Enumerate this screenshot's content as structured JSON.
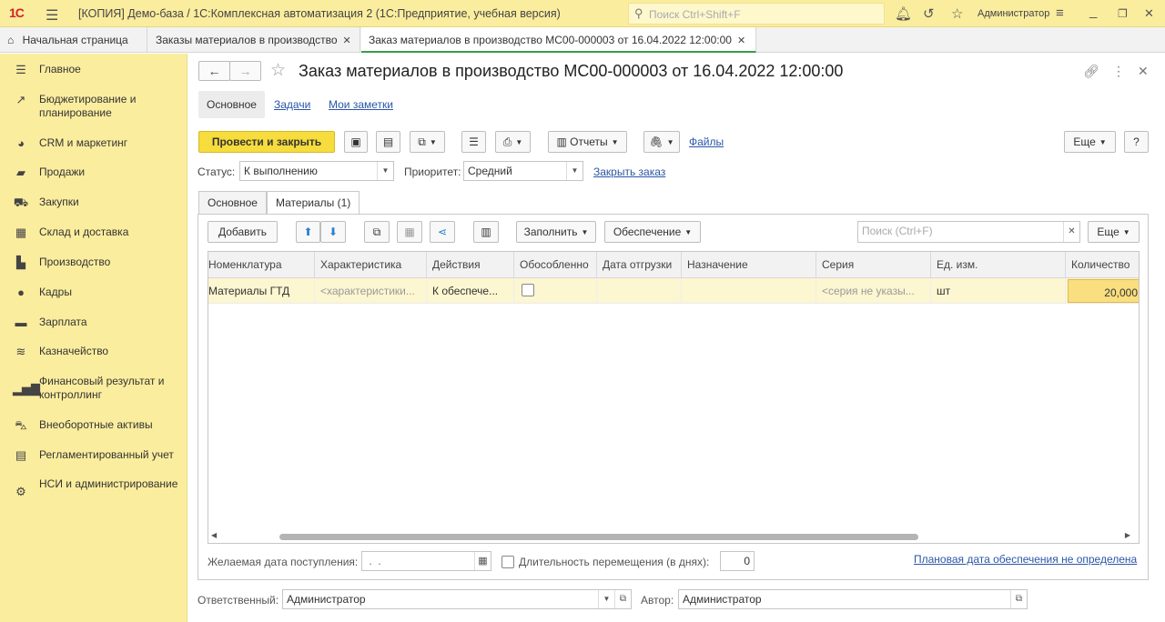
{
  "titlebar": {
    "logo": "1С",
    "title": "[КОПИЯ] Демо-база / 1С:Комплексная автоматизация 2  (1С:Предприятие, учебная версия)",
    "search_placeholder": "Поиск Ctrl+Shift+F",
    "user": "Администратор"
  },
  "tabs": [
    {
      "label": "Начальная страница"
    },
    {
      "label": "Заказы материалов в производство"
    },
    {
      "label": "Заказ материалов в производство МС00-000003 от 16.04.2022 12:00:00"
    }
  ],
  "sidebar": {
    "items": [
      {
        "label": "Главное",
        "icon": "menu-icon"
      },
      {
        "label": "Бюджетирование и планирование",
        "icon": "chart-icon"
      },
      {
        "label": "CRM и маркетинг",
        "icon": "pie-icon"
      },
      {
        "label": "Продажи",
        "icon": "bag-icon"
      },
      {
        "label": "Закупки",
        "icon": "cart-icon"
      },
      {
        "label": "Склад и доставка",
        "icon": "warehouse-icon"
      },
      {
        "label": "Производство",
        "icon": "factory-icon"
      },
      {
        "label": "Кадры",
        "icon": "person-icon"
      },
      {
        "label": "Зарплата",
        "icon": "wallet-icon"
      },
      {
        "label": "Казначейство",
        "icon": "coins-icon"
      },
      {
        "label": "Финансовый результат и контроллинг",
        "icon": "bar-chart-icon"
      },
      {
        "label": "Внеоборотные активы",
        "icon": "car-icon"
      },
      {
        "label": "Регламентированный учет",
        "icon": "document-icon"
      },
      {
        "label": "НСИ и администрирование",
        "icon": "gear-icon"
      }
    ]
  },
  "form": {
    "title": "Заказ материалов в производство МС00-000003 от 16.04.2022 12:00:00",
    "subtabs": [
      "Основное",
      "Задачи",
      "Мои заметки"
    ],
    "post_close": "Провести и закрыть",
    "reports": "Отчеты",
    "files": "Файлы",
    "more": "Еще",
    "help": "?",
    "status_label": "Статус:",
    "status_value": "К выполнению",
    "priority_label": "Приоритет:",
    "priority_value": "Средний",
    "close_order": "Закрыть заказ",
    "inner_tabs": [
      "Основное",
      "Материалы (1)"
    ]
  },
  "table_toolbar": {
    "add": "Добавить",
    "fill": "Заполнить",
    "supply": "Обеспечение",
    "search_placeholder": "Поиск (Ctrl+F)",
    "more": "Еще"
  },
  "table": {
    "columns": [
      "Номенклатура",
      "Характеристика",
      "Действия",
      "Обособленно",
      "Дата отгрузки",
      "Назначение",
      "Серия",
      "Ед. изм.",
      "Количество"
    ],
    "rows": [
      {
        "nomenclature": "Материалы ГТД",
        "characteristic": "<характеристики...",
        "action": "К обеспече...",
        "separate": false,
        "ship_date": "",
        "purpose": "",
        "series": "<серия не указы...",
        "unit": "шт",
        "quantity": "20,000"
      }
    ]
  },
  "bottom": {
    "desired_date_label": "Желаемая дата поступления:",
    "desired_date_value": " .  .",
    "duration_label": "Длительность перемещения (в днях):",
    "duration_value": "0",
    "plan_link": "Плановая дата обеспечения не определена"
  },
  "footer": {
    "responsible_label": "Ответственный:",
    "responsible_value": "Администратор",
    "author_label": "Автор:",
    "author_value": "Администратор"
  }
}
